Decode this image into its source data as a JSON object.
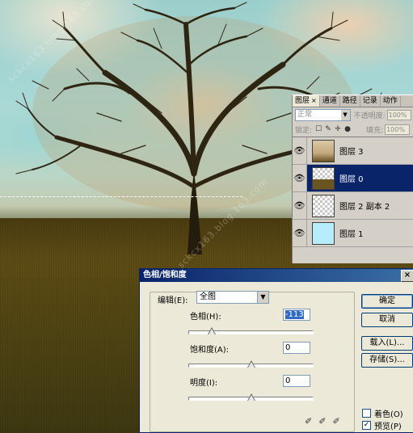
{
  "watermark": {
    "text": "sckcx163.blog.163.com"
  },
  "layers_panel": {
    "tabs": [
      {
        "label": "图层",
        "close": "×"
      },
      {
        "label": "通道"
      },
      {
        "label": "路径"
      },
      {
        "label": "记录"
      },
      {
        "label": "动作"
      }
    ],
    "blend_mode": "正常",
    "opacity_label": "不透明度:",
    "opacity_value": "100%",
    "lock_label": "锁定:",
    "fill_label": "填充:",
    "fill_value": "100%",
    "layers": [
      {
        "name": "图层 3",
        "thumb": "tree",
        "selected": false
      },
      {
        "name": "图层 0",
        "thumb": "checker-ground",
        "selected": true
      },
      {
        "name": "图层 2 副本 2",
        "thumb": "checker",
        "selected": false
      },
      {
        "name": "图层 1",
        "thumb": "cyan",
        "selected": false
      }
    ]
  },
  "dialog": {
    "title": "色相/饱和度",
    "close": "×",
    "edit_label": "编辑(E):",
    "edit_value": "全图",
    "hue": {
      "label": "色相(H):",
      "value": "-113",
      "min": -180,
      "max": 180
    },
    "saturation": {
      "label": "饱和度(A):",
      "value": "0",
      "min": -100,
      "max": 100
    },
    "lightness": {
      "label": "明度(I):",
      "value": "0",
      "min": -100,
      "max": 100
    },
    "buttons": {
      "ok": "确定",
      "cancel": "取消",
      "load": "载入(L)...",
      "save": "存储(S)..."
    },
    "colorize": {
      "label": "着色(O)",
      "checked": false
    },
    "preview": {
      "label": "预览(P)",
      "checked": true
    }
  }
}
